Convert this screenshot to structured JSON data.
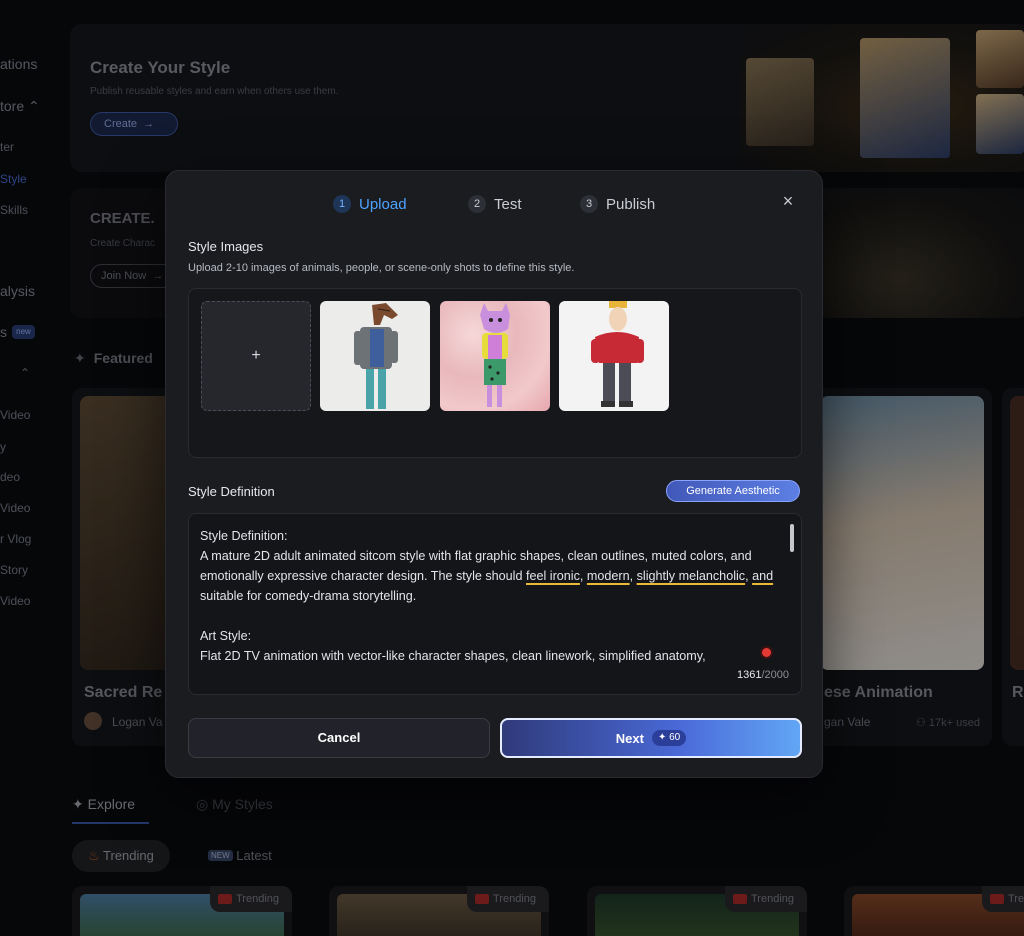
{
  "sidebar": {
    "items": [
      "ations",
      "tore",
      "ter",
      "Style",
      "Skills",
      "alysis",
      "s",
      "Video",
      "y",
      "deo",
      "Video",
      "r Vlog",
      "Story",
      "Video"
    ],
    "new_badge": "new"
  },
  "banner_create": {
    "title": "Create Your Style",
    "subtitle": "Publish reusable styles and earn when others use them.",
    "button": "Create"
  },
  "banner_create2": {
    "title": "CREATE.",
    "subtitle": "Create Charac",
    "button": "Join Now"
  },
  "featured": {
    "heading": "Featured",
    "cards": [
      {
        "title": "Sacred Re",
        "author": "Logan Va"
      },
      {
        "title": "ese Animation",
        "author": "gan Vale",
        "used": "17k+ used"
      },
      {
        "title": "R",
        "author": ""
      }
    ]
  },
  "explore": {
    "tab_explore": "Explore",
    "tab_my_styles": "My Styles",
    "filter_trending": "Trending",
    "filter_latest": "Latest",
    "latest_badge": "NEW",
    "card_tag": "Trending"
  },
  "modal": {
    "steps": [
      {
        "num": "1",
        "label": "Upload"
      },
      {
        "num": "2",
        "label": "Test"
      },
      {
        "num": "3",
        "label": "Publish"
      }
    ],
    "close": "×",
    "style_images_title": "Style Images",
    "style_images_hint": "Upload 2-10 images of animals, people, or scene-only shots to define this style.",
    "add_symbol": "+",
    "style_definition_title": "Style Definition",
    "generate_button": "Generate Aesthetic",
    "definition": {
      "heading": "Style Definition:",
      "p1_a": "A mature 2D adult animated sitcom style with flat graphic shapes, clean outlines, muted colors, and emotionally expressive character design. The style should ",
      "p1_u1": "feel ironic",
      "p1_c1": ", ",
      "p1_u2": "modern",
      "p1_c2": ", ",
      "p1_u3": "slightly melancholic",
      "p1_c3": ", ",
      "p1_u4": "and",
      "p1_b": " suitable for comedy-drama storytelling.",
      "art_heading": "Art Style:",
      "art_text": "Flat 2D TV animation with vector-like character shapes, clean linework, simplified anatomy,"
    },
    "counter_current": "1361",
    "counter_max": "/2000",
    "cancel_button": "Cancel",
    "next_button": "Next",
    "next_cost": "60"
  }
}
